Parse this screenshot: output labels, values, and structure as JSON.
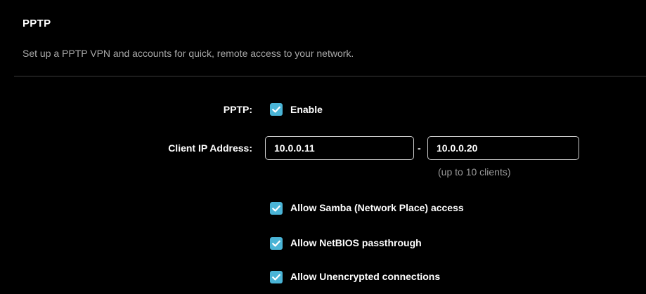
{
  "section": {
    "title": "PPTP",
    "description": "Set up a PPTP VPN and accounts for quick, remote access to your network."
  },
  "pptp": {
    "label": "PPTP:",
    "enable_label": "Enable",
    "enabled": true
  },
  "client_ip": {
    "label": "Client IP Address:",
    "start_value": "10.0.0.11",
    "separator": "-",
    "end_value": "10.0.0.20",
    "hint": "(up to 10 clients)"
  },
  "options": [
    {
      "label": "Allow Samba (Network Place) access",
      "checked": true
    },
    {
      "label": "Allow NetBIOS passthrough",
      "checked": true
    },
    {
      "label": "Allow Unencrypted connections",
      "checked": true
    }
  ],
  "colors": {
    "background": "#000000",
    "checkbox_accent": "#4ab4d6",
    "description_text": "#a9a9a9",
    "hint_text": "#9a9a9a",
    "input_border": "#cfcfcf"
  }
}
